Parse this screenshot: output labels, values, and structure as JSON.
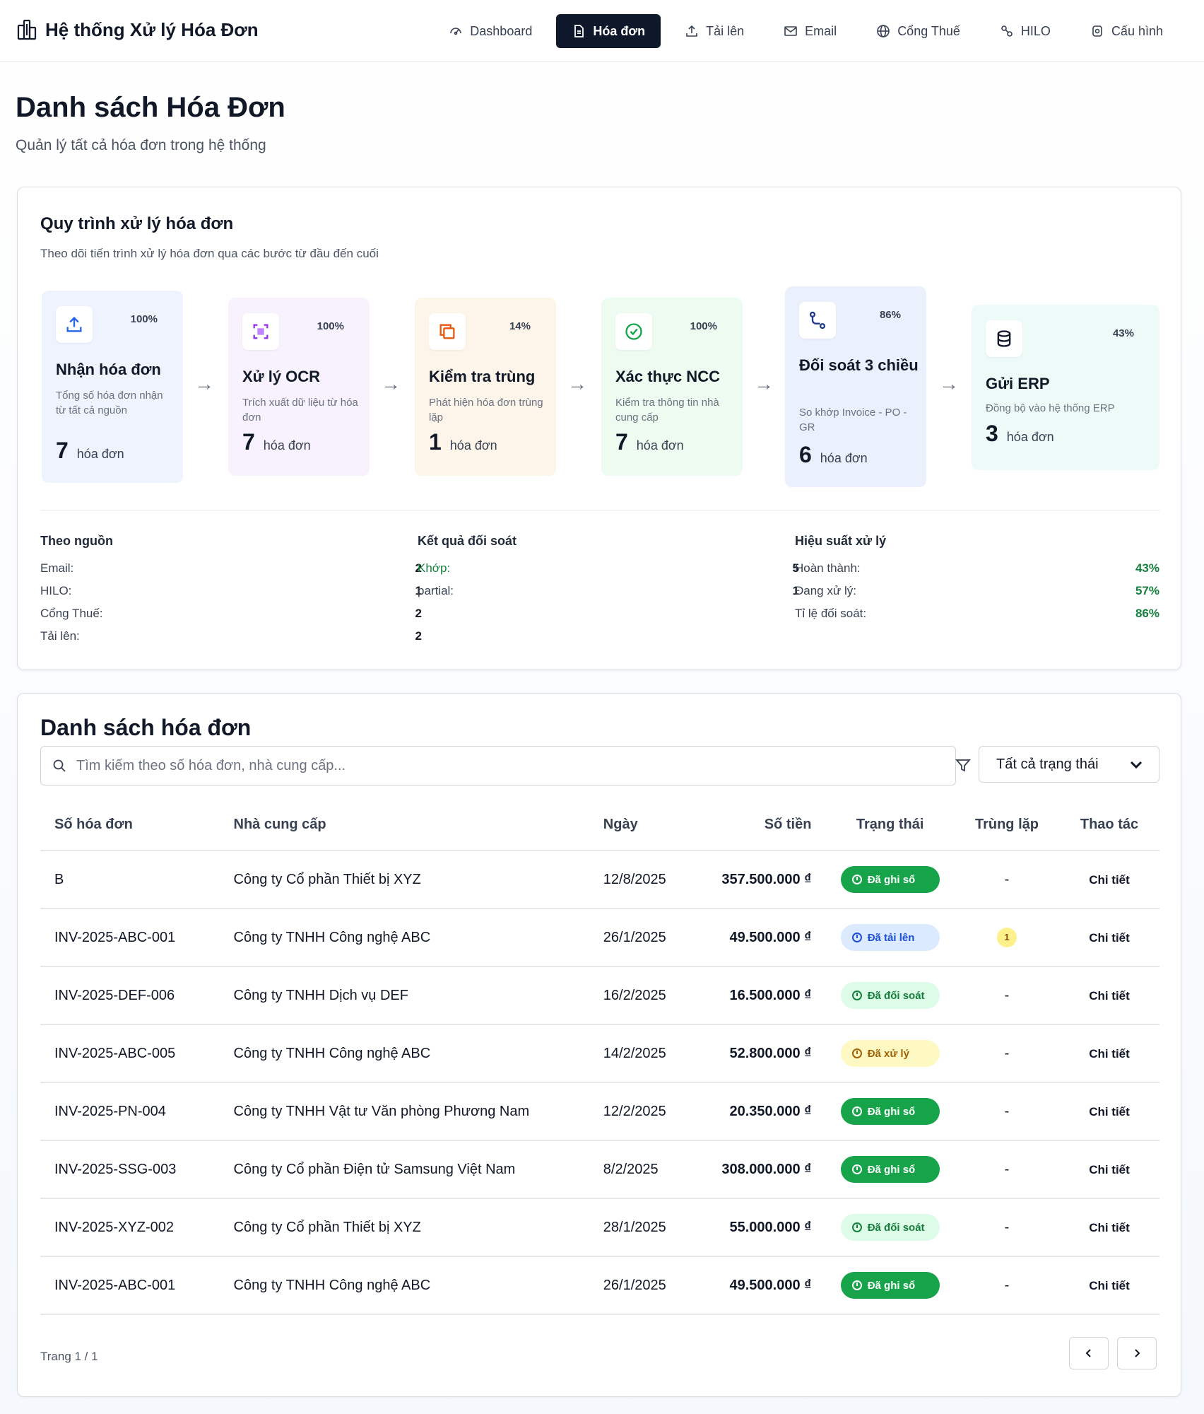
{
  "header": {
    "brand": "Hệ thống Xử lý Hóa Đơn",
    "nav": [
      {
        "label": "Dashboard",
        "icon": "dashboard-icon"
      },
      {
        "label": "Hóa đơn",
        "icon": "file-icon",
        "active": true
      },
      {
        "label": "Tải lên",
        "icon": "upload-icon"
      },
      {
        "label": "Email",
        "icon": "mail-icon"
      },
      {
        "label": "Cổng Thuế",
        "icon": "globe-icon"
      },
      {
        "label": "HILO",
        "icon": "link-icon"
      },
      {
        "label": "Cấu hình",
        "icon": "settings-icon"
      }
    ]
  },
  "page": {
    "title": "Danh sách Hóa Đơn",
    "subtitle": "Quản lý tất cả hóa đơn trong hệ thống"
  },
  "workflow": {
    "title": "Quy trình xử lý hóa đơn",
    "subtitle": "Theo dõi tiến trình xử lý hóa đơn qua các bước từ đầu đến cuối",
    "steps": [
      {
        "title": "Nhận hóa đơn",
        "desc": "Tổng số hóa đơn nhận từ tất cả nguồn",
        "percent": "100%",
        "count": "7",
        "unit": "hóa đơn",
        "icon": "upload-icon",
        "bg": "#eef3fd"
      },
      {
        "title": "Xử lý OCR",
        "desc": "Trích xuất dữ liệu từ hóa đơn",
        "percent": "100%",
        "count": "7",
        "unit": "hóa đơn",
        "icon": "scan-icon",
        "bg": "#f7f2fd"
      },
      {
        "title": "Kiểm tra trùng",
        "desc": "Phát hiện hóa đơn trùng lặp",
        "percent": "14%",
        "count": "1",
        "unit": "hóa đơn",
        "icon": "copy-icon",
        "bg": "#fdf4ea"
      },
      {
        "title": "Xác thực NCC",
        "desc": "Kiểm tra thông tin nhà cung cấp",
        "percent": "100%",
        "count": "7",
        "unit": "hóa đơn",
        "icon": "check-circle-icon",
        "bg": "#eefbf1"
      },
      {
        "title": "Đối soát 3 chiều",
        "desc": "So khớp Invoice - PO - GR",
        "percent": "86%",
        "count": "6",
        "unit": "hóa đơn",
        "icon": "route-icon",
        "bg": "#eaf0fc"
      },
      {
        "title": "Gửi ERP",
        "desc": "Đồng bộ vào hệ thống ERP",
        "percent": "43%",
        "count": "3",
        "unit": "hóa đơn",
        "icon": "database-icon",
        "bg": "#eefaf8"
      }
    ],
    "by_source": {
      "title": "Theo nguồn",
      "rows": [
        {
          "label": "Email:",
          "value": "2"
        },
        {
          "label": "HILO:",
          "value": "1"
        },
        {
          "label": "Cổng Thuế:",
          "value": "2"
        },
        {
          "label": "Tải lên:",
          "value": "2"
        }
      ]
    },
    "reconcile": {
      "title": "Kết quả đối soát",
      "rows": [
        {
          "label": "Khớp:",
          "value": "5"
        },
        {
          "label": "partial:",
          "value": "1"
        }
      ]
    },
    "performance": {
      "title": "Hiệu suất xử lý",
      "rows": [
        {
          "label": "Hoàn thành:",
          "value": "43%"
        },
        {
          "label": "Đang xử lý:",
          "value": "57%"
        },
        {
          "label": "Tỉ lệ đối soát:",
          "value": "86%"
        }
      ]
    }
  },
  "list": {
    "title": "Danh sách hóa đơn",
    "search_placeholder": "Tìm kiếm theo số hóa đơn, nhà cung cấp...",
    "status_filter": "Tất cả trạng thái",
    "columns": [
      "Số hóa đơn",
      "Nhà cung cấp",
      "Ngày",
      "Số tiền",
      "Trạng thái",
      "Trùng lặp",
      "Thao tác"
    ],
    "rows": [
      {
        "code": "B",
        "vendor": "Công ty Cổ phần Thiết bị XYZ",
        "date": "12/8/2025",
        "amount": "357.500.000 ₫",
        "status": "Đã ghi sổ",
        "status_type": "ghi",
        "dup": "-",
        "action": "Chi tiết"
      },
      {
        "code": "INV-2025-ABC-001",
        "vendor": "Công ty TNHH Công nghệ ABC",
        "date": "26/1/2025",
        "amount": "49.500.000 ₫",
        "status": "Đã tải lên",
        "status_type": "tai",
        "dup": "1",
        "action": "Chi tiết"
      },
      {
        "code": "INV-2025-DEF-006",
        "vendor": "Công ty TNHH Dịch vụ DEF",
        "date": "16/2/2025",
        "amount": "16.500.000 ₫",
        "status": "Đã đối soát",
        "status_type": "doi",
        "dup": "-",
        "action": "Chi tiết"
      },
      {
        "code": "INV-2025-ABC-005",
        "vendor": "Công ty TNHH Công nghệ ABC",
        "date": "14/2/2025",
        "amount": "52.800.000 ₫",
        "status": "Đã xử lý",
        "status_type": "xu",
        "dup": "-",
        "action": "Chi tiết"
      },
      {
        "code": "INV-2025-PN-004",
        "vendor": "Công ty TNHH Vật tư Văn phòng Phương Nam",
        "date": "12/2/2025",
        "amount": "20.350.000 ₫",
        "status": "Đã ghi sổ",
        "status_type": "ghi",
        "dup": "-",
        "action": "Chi tiết"
      },
      {
        "code": "INV-2025-SSG-003",
        "vendor": "Công ty Cổ phần Điện tử Samsung Việt Nam",
        "date": "8/2/2025",
        "amount": "308.000.000 ₫",
        "status": "Đã ghi sổ",
        "status_type": "ghi",
        "dup": "-",
        "action": "Chi tiết"
      },
      {
        "code": "INV-2025-XYZ-002",
        "vendor": "Công ty Cổ phần Thiết bị XYZ",
        "date": "28/1/2025",
        "amount": "55.000.000 ₫",
        "status": "Đã đối soát",
        "status_type": "doi",
        "dup": "-",
        "action": "Chi tiết"
      },
      {
        "code": "INV-2025-ABC-001",
        "vendor": "Công ty TNHH Công nghệ ABC",
        "date": "26/1/2025",
        "amount": "49.500.000 ₫",
        "status": "Đã ghi sổ",
        "status_type": "ghi",
        "dup": "-",
        "action": "Chi tiết"
      }
    ],
    "pager": "Trang 1 / 1"
  }
}
